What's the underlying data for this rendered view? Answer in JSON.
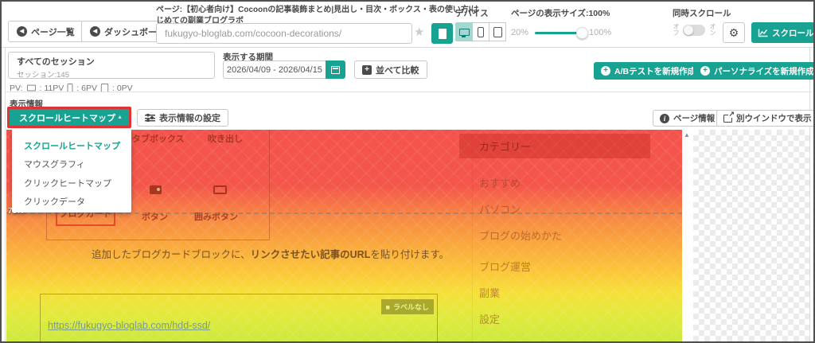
{
  "colors": {
    "accent_teal": "#18a291",
    "highlight_red": "#e03434",
    "heat_top_red": "#f4564a",
    "heat_bottom_green": "#cde93f",
    "device_active_bg": "#a3d7cf"
  },
  "icons": {
    "arrow_back": "◀",
    "star": "★",
    "gear": "⚙",
    "caret_up": "▲",
    "scroll_up": "▲",
    "ext_arrow": "↗",
    "plus": "+",
    "info": "i",
    "badge_square": "■"
  },
  "topbar": {
    "page_list": "ページ一覧",
    "dashboard": "ダッシュボード",
    "page_label": "ページ:【初心者向け】Cocoonの記事装飾まとめ|見出し・目次・ボックス・表の使い方|はじめての副業ブログラボ",
    "url": "fukugyo-bloglab.com/cocoon-decorations/",
    "device_label": "デバイス",
    "zoom_label": "ページの表示サイズ:100%",
    "zoom_min": "20%",
    "zoom_max": "100%",
    "sync_label": "同時スクロール",
    "sync_off": "オフ",
    "sync_on": "オン",
    "scroll_data": "スクロールデータ"
  },
  "session": {
    "title": "すべてのセッション",
    "count": "セッション:145",
    "period_label": "表示する期間",
    "period_value": "2026/04/09 - 2026/04/15",
    "compare": "並べて比較",
    "pv_label": "PV:",
    "pv": [
      {
        "device": "desktop",
        "value": ": 11PV"
      },
      {
        "device": "phone",
        "value": ": 6PV"
      },
      {
        "device": "tablet",
        "value": ": 0PV"
      }
    ],
    "ab_test": "A/Bテストを新規作成",
    "personalize": "パーソナライズを新規作成"
  },
  "display": {
    "label": "表示情報",
    "dropdown_value": "スクロールヒートマップ",
    "settings": "表示情報の設定",
    "page_info": "ページ情報",
    "new_window": "別ウインドウで表示",
    "menu_items": [
      "スクロールヒートマップ",
      "マウスグラフィ",
      "クリックヒートマップ",
      "クリックデータ"
    ]
  },
  "heatmap": {
    "scroll_marker": "75%",
    "table_row1_col1": "タブボックス",
    "table_row1_col2": "吹き出し",
    "blogcard": "ブログカード",
    "button_label": "ボタン",
    "frame_button_label": "囲みボタン",
    "paragraph_prefix": "追加したブログカードブロックに、",
    "paragraph_bold": "リンクさせたい記事のURL",
    "paragraph_suffix": "を貼り付けます。",
    "link_url": "https://fukugyo-bloglab.com/hdd-ssd/",
    "label_badge": "ラベルなし",
    "sidebar_title": "カテゴリー",
    "sidebar_items": [
      "おすすめ",
      "パソコン",
      "ブログの始めかた",
      "ブログ運営",
      "副業",
      "設定"
    ]
  }
}
